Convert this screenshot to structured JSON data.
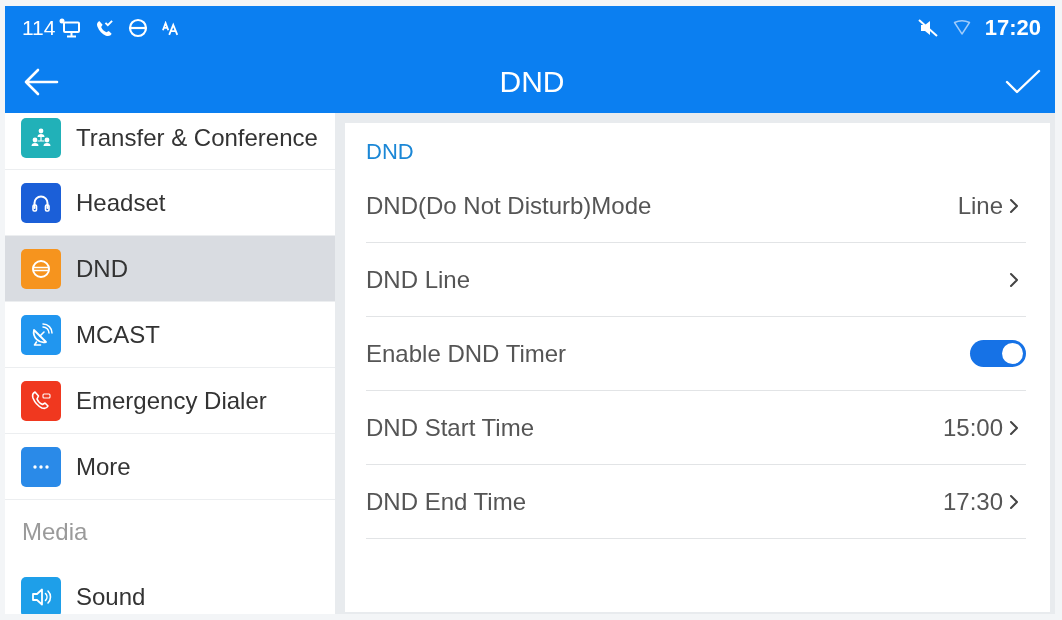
{
  "status_bar": {
    "extension": "114",
    "time": "17:20"
  },
  "title_bar": {
    "title": "DND"
  },
  "sidebar": {
    "groups": [
      {
        "items": [
          {
            "label": "Transfer & Conference",
            "selected": false,
            "color": "#21b1b8"
          },
          {
            "label": "Headset",
            "selected": false,
            "color": "#1b5fd8"
          },
          {
            "label": "DND",
            "selected": true,
            "color": "#f6941e"
          },
          {
            "label": "MCAST",
            "selected": false,
            "color": "#2196ef"
          },
          {
            "label": "Emergency Dialer",
            "selected": false,
            "color": "#f0381f"
          },
          {
            "label": "More",
            "selected": false,
            "color": "#2a8ae8"
          }
        ]
      },
      {
        "title": "Media",
        "items": [
          {
            "label": "Sound",
            "selected": false,
            "color": "#1e9fe9"
          }
        ]
      }
    ]
  },
  "panel": {
    "section_title": "DND",
    "rows": [
      {
        "kind": "link",
        "label": "DND(Do Not Disturb)Mode",
        "value": "Line"
      },
      {
        "kind": "link",
        "label": "DND Line"
      },
      {
        "kind": "toggle",
        "label": "Enable DND Timer",
        "on": true
      },
      {
        "kind": "link",
        "label": "DND Start Time",
        "value": "15:00"
      },
      {
        "kind": "link",
        "label": "DND End Time",
        "value": "17:30"
      }
    ]
  }
}
